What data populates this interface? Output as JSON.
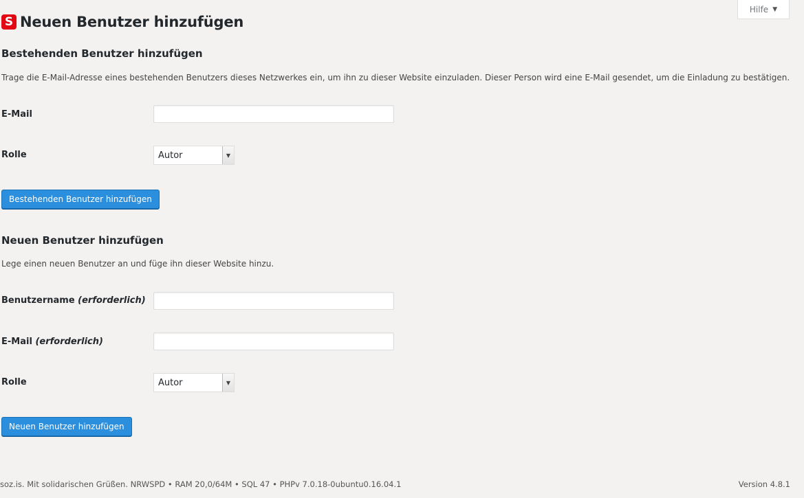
{
  "help": {
    "label": "Hilfe",
    "arrow": "▼"
  },
  "header": {
    "logo_letter": "S",
    "title": "Neuen Benutzer hinzufügen",
    "brand_color": "#e30613"
  },
  "existing_user": {
    "heading": "Bestehenden Benutzer hinzufügen",
    "description": "Trage die E-Mail-Adresse eines bestehenden Benutzers dieses Netzwerkes ein, um ihn zu dieser Website einzuladen. Dieser Person wird eine E-Mail gesendet, um die Einladung zu bestätigen.",
    "email_label": "E-Mail",
    "email_value": "",
    "role_label": "Rolle",
    "role_value": "Autor",
    "submit_label": "Bestehenden Benutzer hinzufügen"
  },
  "new_user": {
    "heading": "Neuen Benutzer hinzufügen",
    "description": "Lege einen neuen Benutzer an und füge ihn dieser Website hinzu.",
    "username_label": "Benutzername",
    "username_required": "(erforderlich)",
    "username_value": "",
    "email_label": "E-Mail",
    "email_required": "(erforderlich)",
    "email_value": "",
    "role_label": "Rolle",
    "role_value": "Autor",
    "submit_label": "Neuen Benutzer hinzufügen"
  },
  "footer": {
    "left": "soz.is. Mit solidarischen Grüßen. NRWSPD • RAM 20,0/64M • SQL 47 • PHPv 7.0.18-0ubuntu0.16.04.1",
    "version": "Version 4.8.1"
  },
  "colors": {
    "background": "#f3f2f1",
    "button": "#2c8fdd"
  }
}
